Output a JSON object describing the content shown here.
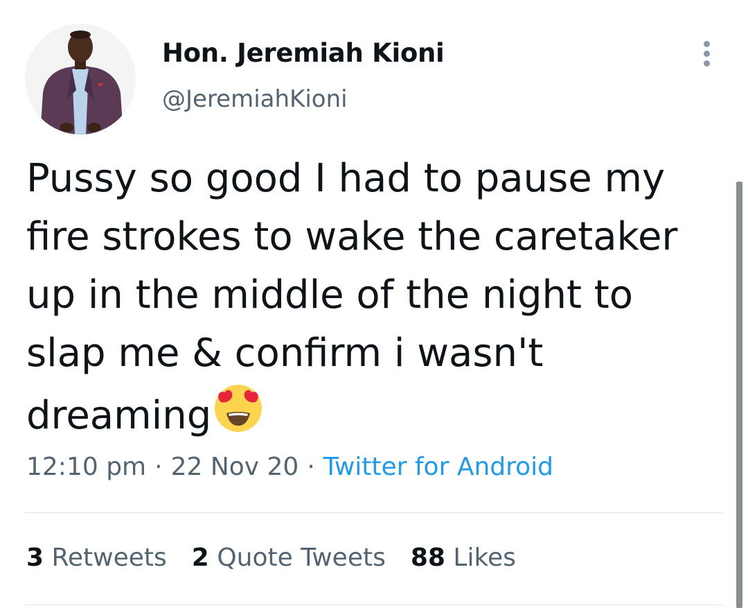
{
  "tweet": {
    "author": {
      "display_name": "Hon. Jeremiah Kioni",
      "handle": "@JeremiahKioni",
      "avatar_icon": "profile-photo"
    },
    "more_icon": "more-vertical-icon",
    "text_lines": [
      "Pussy so good I had to pause my",
      "fire strokes to wake the caretaker",
      "up in the middle of the night to",
      "slap me & confirm i wasn't",
      "dreaming"
    ],
    "emoji": "smiling-face-with-heart-eyes",
    "time": "12:10 pm",
    "date": "22 Nov 20",
    "separator": "·",
    "source": "Twitter for Android",
    "stats": {
      "retweets_count": "3",
      "retweets_label": "Retweets",
      "quotes_count": "2",
      "quotes_label": "Quote Tweets",
      "likes_count": "88",
      "likes_label": "Likes"
    }
  },
  "colors": {
    "text_primary": "#0f1419",
    "text_secondary": "#536471",
    "link": "#1d9bf0",
    "divider": "#dfe3e6",
    "scrollbar": "#8a8f94"
  }
}
